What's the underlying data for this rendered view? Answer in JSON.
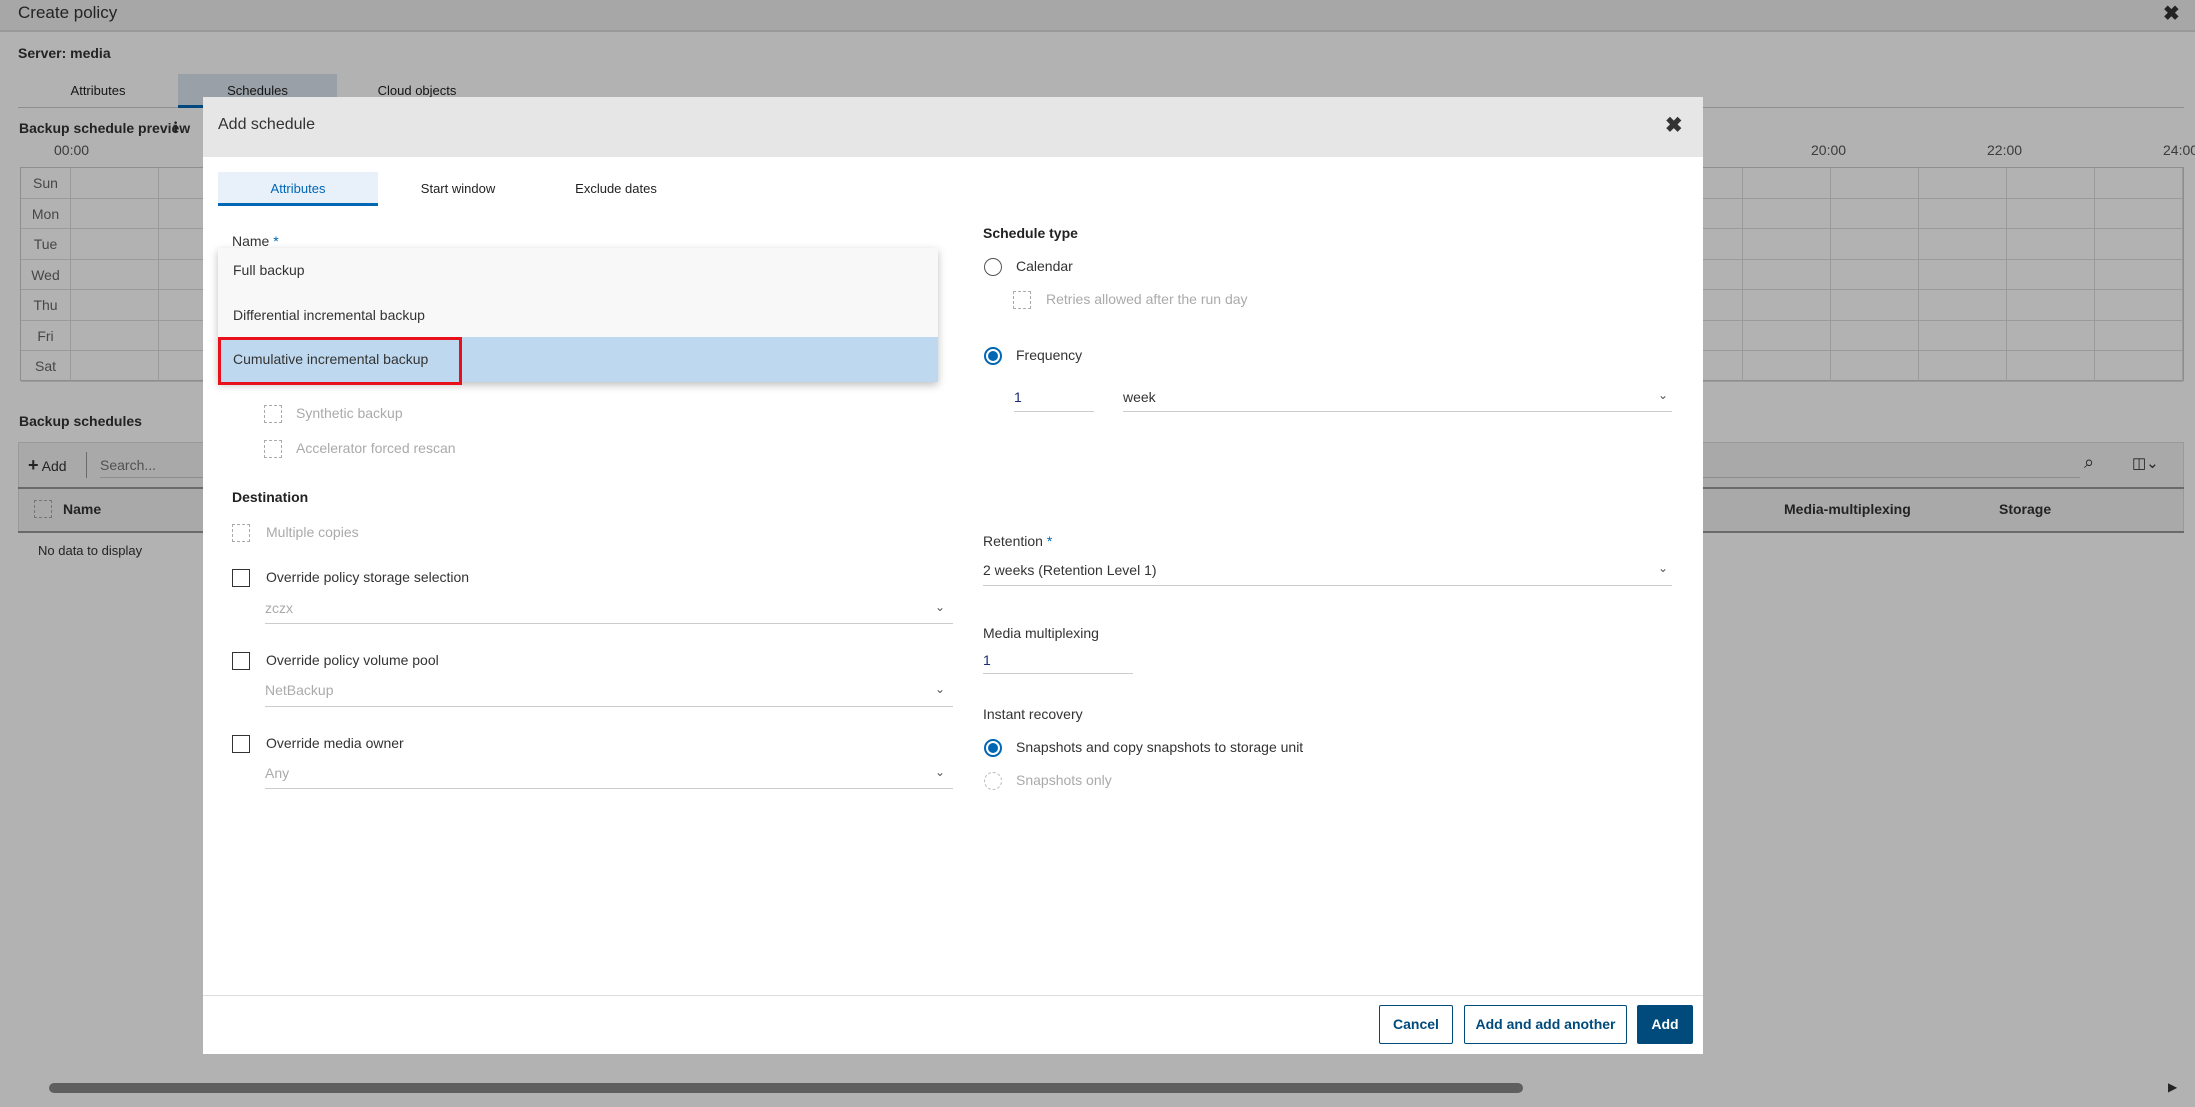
{
  "page": {
    "title": "Create policy",
    "server_label": "Server: media",
    "tabs": [
      {
        "label": "Attributes"
      },
      {
        "label": "Schedules",
        "active": true
      },
      {
        "label": "Cloud objects"
      }
    ],
    "preview_title": "Backup schedule preview",
    "preview_hours": [
      "00:00",
      "20:00",
      "22:00",
      "24:00"
    ],
    "days": [
      "Sun",
      "Mon",
      "Tue",
      "Wed",
      "Thu",
      "Fri",
      "Sat"
    ],
    "schedules_title": "Backup schedules",
    "add_label": "Add",
    "search_placeholder": "Search...",
    "columns": {
      "name": "Name",
      "media_multiplexing": "Media-multiplexing",
      "storage": "Storage"
    },
    "empty_text": "No data to display"
  },
  "modal": {
    "title": "Add schedule",
    "tabs": [
      {
        "label": "Attributes",
        "active": true
      },
      {
        "label": "Start window"
      },
      {
        "label": "Exclude dates"
      }
    ],
    "name_label": "Name",
    "required_mark": "*",
    "name_options": [
      {
        "label": "Full backup"
      },
      {
        "label": "Differential incremental backup"
      },
      {
        "label": "Cumulative incremental backup",
        "selected": true
      }
    ],
    "synthetic_backup": "Synthetic backup",
    "accelerator_rescan": "Accelerator forced rescan",
    "destination_title": "Destination",
    "multiple_copies": "Multiple copies",
    "override_storage": {
      "label": "Override policy storage selection",
      "value": "zczx",
      "checked": false
    },
    "override_volume_pool": {
      "label": "Override policy volume pool",
      "value": "NetBackup",
      "checked": false
    },
    "override_media_owner": {
      "label": "Override media owner",
      "value": "Any",
      "checked": false
    },
    "schedule_type_title": "Schedule type",
    "calendar_label": "Calendar",
    "retries_label": "Retries allowed after the run day",
    "frequency_label": "Frequency",
    "frequency_value": "1",
    "frequency_unit": "week",
    "retention_label": "Retention",
    "retention_value": "2 weeks (Retention Level 1)",
    "media_multiplexing_label": "Media multiplexing",
    "media_multiplexing_value": "1",
    "instant_recovery_title": "Instant recovery",
    "ir_option1": "Snapshots and copy snapshots to storage unit",
    "ir_option2": "Snapshots only",
    "buttons": {
      "cancel": "Cancel",
      "add_another": "Add and add another",
      "add": "Add"
    }
  },
  "colors": {
    "accent": "#0067b4",
    "primary_button": "#004a7c",
    "selected_option": "#bed9ef",
    "highlight_box": "#e8101a"
  }
}
